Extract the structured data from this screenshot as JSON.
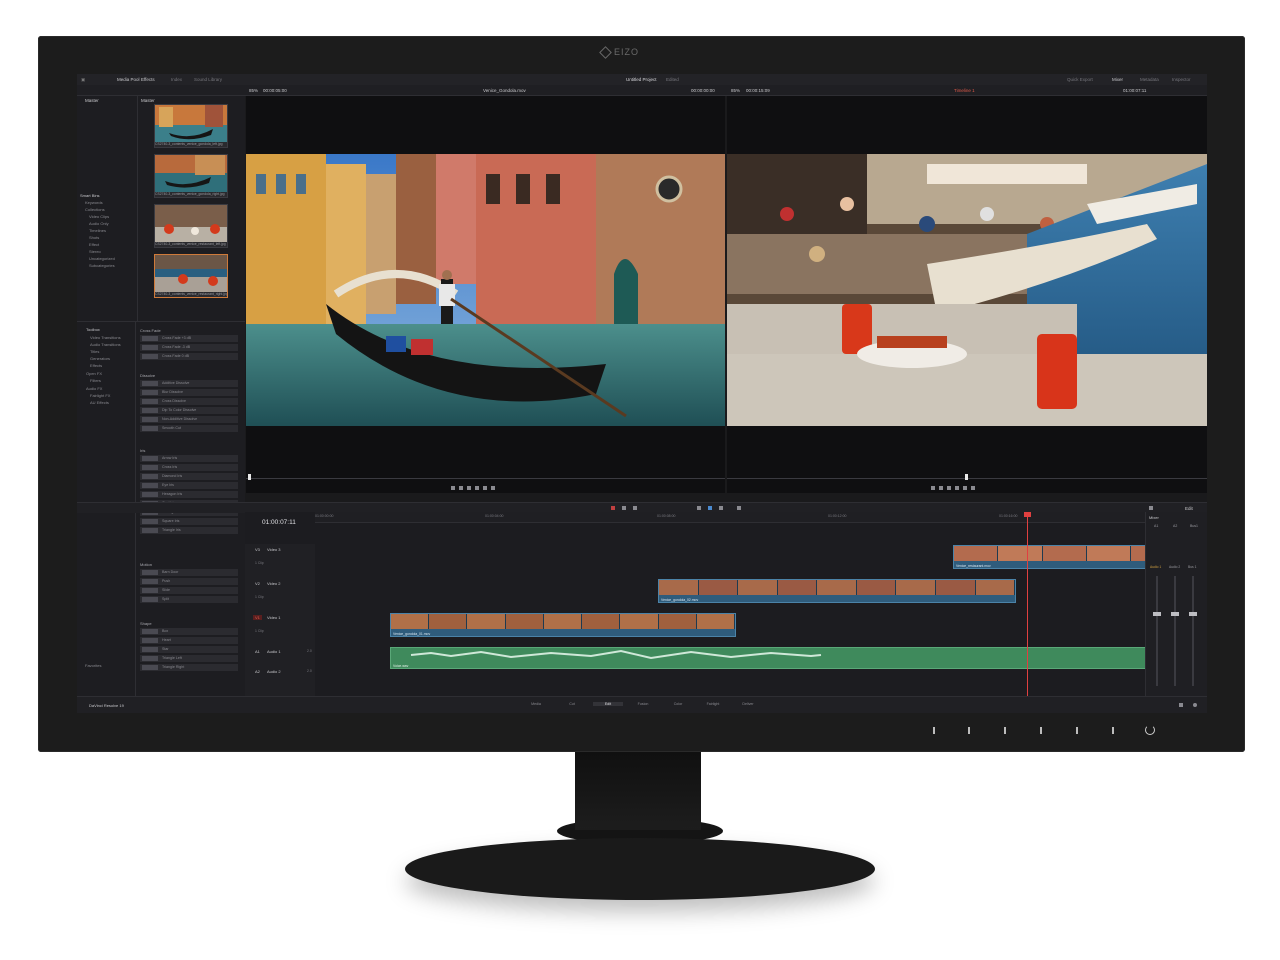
{
  "monitor": {
    "brand": "EIZO"
  },
  "app": {
    "name": "DaVinci Resolve 19",
    "project_title": "Untitled Project",
    "project_state": "Edited"
  },
  "toolbar": {
    "media_pool": "Media Pool",
    "effects": "Effects",
    "index": "Index",
    "sound_library": "Sound Library",
    "quick_export": "Quick Export",
    "mixer": "Mixer",
    "metadata": "Metadata",
    "inspector": "Inspector"
  },
  "source_viewer": {
    "zoom": "85%",
    "timecode_in": "00:00:05:00",
    "clip_name": "Venice_Gondola.mov",
    "timecode": "00:00:00:00"
  },
  "timeline_viewer": {
    "zoom": "85%",
    "duration": "00:00:15:09",
    "timeline_name": "Timeline 1",
    "timecode": "01:00:07:11"
  },
  "media_pool": {
    "header_left": "Master",
    "header_right": "Master",
    "thumbs": [
      "CS2740-3_contents_venice_gondola_left.jpg",
      "CS2740-3_contents_venice_gondola_right.jpg",
      "CS2740-3_contents_venice_restaurant_left.jpg",
      "CS2740-3_contents_venice_restaurant_right.jpg"
    ],
    "smart_bins_title": "Smart Bins",
    "smart_bins": [
      "Keywords",
      "Collections",
      "Video Clips",
      "Audio Only",
      "Timelines",
      "Shots",
      "Effect",
      "Stereo",
      "Uncategorized",
      "Subcategories"
    ]
  },
  "effects_panel": {
    "toolbox_title": "Toolbox",
    "toolbox_items": [
      "Video Transitions",
      "Audio Transitions",
      "Titles",
      "Generators",
      "Effects",
      "Open FX",
      "Filters",
      "Audio FX",
      "Fairlight FX",
      "AU Effects"
    ],
    "favorites": "Favorites",
    "groups": [
      {
        "name": "Cross Fade",
        "items": [
          "Cross Fade +3 dB",
          "Cross Fade -3 dB",
          "Cross Fade 0 dB"
        ]
      },
      {
        "name": "Dissolve",
        "items": [
          "Additive Dissolve",
          "Blur Dissolve",
          "Cross Dissolve",
          "Dip To Color Dissolve",
          "Non-Additive Dissolve",
          "Smooth Cut"
        ]
      },
      {
        "name": "Iris",
        "items": [
          "Arrow Iris",
          "Cross Iris",
          "Diamond Iris",
          "Eye Iris",
          "Hexagon Iris",
          "Oval Iris",
          "Pentagon Iris",
          "Square Iris",
          "Triangle Iris"
        ]
      },
      {
        "name": "Motion",
        "items": [
          "Barn Door",
          "Push",
          "Slide",
          "Split"
        ]
      },
      {
        "name": "Shape",
        "items": [
          "Box",
          "Heart",
          "Star",
          "Triangle Left",
          "Triangle Right"
        ]
      }
    ]
  },
  "timeline": {
    "timecode": "01:00:07:11",
    "ruler": [
      "01:00:00:00",
      "01:00:04:00",
      "01:00:08:00",
      "01:00:12:00",
      "01:00:16:00"
    ],
    "tracks": [
      {
        "id": "V3",
        "name": "Video 3",
        "clips": "1 Clip"
      },
      {
        "id": "V2",
        "name": "Video 2",
        "clips": "1 Clip"
      },
      {
        "id": "V1",
        "name": "Video 1",
        "clips": "1 Clip"
      },
      {
        "id": "A1",
        "name": "Audio 1",
        "level": "2.0"
      },
      {
        "id": "A2",
        "name": "Audio 2",
        "level": "2.0"
      }
    ],
    "clips": {
      "v3": "Venice_restaurant.mov",
      "v2": "Venice_gondola_02.mov",
      "v1": "Venice_gondola_01.mov",
      "a1": "Voice.wav"
    }
  },
  "mixer": {
    "title": "Mixer",
    "channels": [
      "A1",
      "A2",
      "Bus1"
    ],
    "labels": [
      "Audio 1",
      "Audio 2",
      "Bus 1"
    ],
    "edit": "Edit"
  },
  "pages": [
    "Media",
    "Cut",
    "Edit",
    "Fusion",
    "Color",
    "Fairlight",
    "Deliver"
  ],
  "active_page": "Edit",
  "icons": [
    "eizo-logo-icon",
    "power-icon",
    "play-icon",
    "stop-icon",
    "loop-icon",
    "gear-icon",
    "home-icon"
  ]
}
